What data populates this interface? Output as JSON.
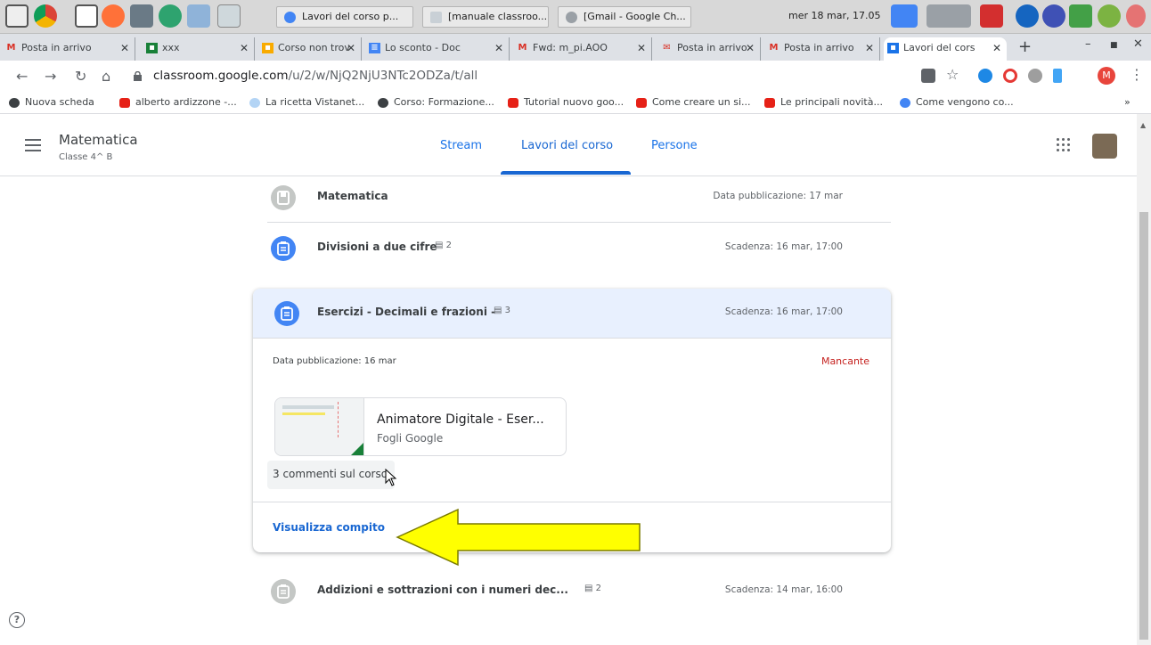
{
  "os": {
    "tasks": [
      "Lavori del corso p...",
      "[manuale classroo...",
      "[Gmail - Google Ch..."
    ],
    "clock": "mer 18 mar, 17.05"
  },
  "browser": {
    "tabs": [
      {
        "label": "Posta in arrivo",
        "icon": "gmail-icon"
      },
      {
        "label": "xxx",
        "icon": "classroom-icon"
      },
      {
        "label": "Corso non trov",
        "icon": "classroom-icon"
      },
      {
        "label": "Lo sconto - Doc",
        "icon": "docs-icon"
      },
      {
        "label": "Fwd: m_pi.AOO",
        "icon": "gmail-icon"
      },
      {
        "label": "Posta in arrivo",
        "icon": "mail-icon"
      },
      {
        "label": "Posta in arrivo",
        "icon": "gmail-icon"
      },
      {
        "label": "Lavori del cors",
        "icon": "classroom-icon",
        "active": true
      }
    ],
    "url_host": "classroom.google.com",
    "url_path": "/u/2/w/NjQ2NjU3NTc2ODZa/t/all",
    "profile_initial": "M",
    "bookmarks": [
      "Nuova scheda",
      "alberto ardizzone -...",
      "La ricetta Vistanet...",
      "Corso: Formazione...",
      "Tutorial nuovo goo...",
      "Come creare un si...",
      "Le principali novità...",
      "Come vengono co..."
    ],
    "bookmarks_more": "»"
  },
  "classroom": {
    "class_name": "Matematica",
    "class_section": "Classe 4^ B",
    "nav": {
      "stream": "Stream",
      "classwork": "Lavori del corso",
      "people": "Persone"
    },
    "items": [
      {
        "title": "Matematica",
        "comments": "",
        "date": "Data pubblicazione: 17 mar",
        "kind": "topic"
      },
      {
        "title": "Divisioni a due cifre",
        "comments": "2",
        "date": "Scadenza: 16 mar, 17:00",
        "kind": "assignment"
      }
    ],
    "expanded": {
      "title": "Esercizi - Decimali e frazioni -",
      "comments": "3",
      "date": "Scadenza: 16 mar, 17:00",
      "published": "Data pubblicazione: 16 mar",
      "status": "Mancante",
      "attachment_title": "Animatore Digitale - Eser...",
      "attachment_type": "Fogli Google",
      "class_comments": "3 commenti sul corso",
      "view_link": "Visualizza compito"
    },
    "last_item": {
      "title": "Addizioni e sottrazioni con i numeri dec...",
      "comments": "2",
      "date": "Scadenza: 14 mar, 16:00"
    },
    "help": "?"
  },
  "colors": {
    "accent": "#1967d2",
    "missing": "#c5221f",
    "arrow": "#ffff00"
  }
}
